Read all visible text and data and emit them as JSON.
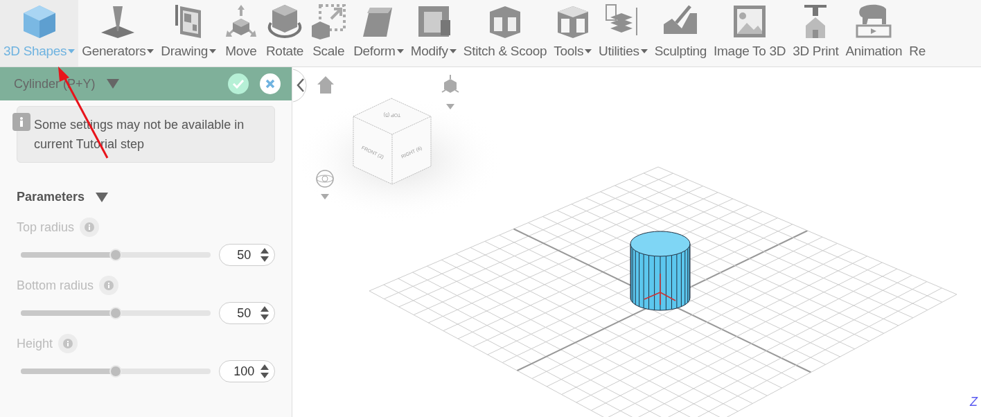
{
  "toolbar": [
    {
      "label": "3D Shapes",
      "dropdown": true,
      "selected": true
    },
    {
      "label": "Generators",
      "dropdown": true,
      "selected": false
    },
    {
      "label": "Drawing",
      "dropdown": true,
      "selected": false
    },
    {
      "label": "Move",
      "dropdown": false,
      "selected": false
    },
    {
      "label": "Rotate",
      "dropdown": false,
      "selected": false
    },
    {
      "label": "Scale",
      "dropdown": false,
      "selected": false
    },
    {
      "label": "Deform",
      "dropdown": true,
      "selected": false
    },
    {
      "label": "Modify",
      "dropdown": true,
      "selected": false
    },
    {
      "label": "Stitch & Scoop",
      "dropdown": false,
      "selected": false
    },
    {
      "label": "Tools",
      "dropdown": true,
      "selected": false
    },
    {
      "label": "Utilities",
      "dropdown": true,
      "selected": false
    },
    {
      "label": "Sculpting",
      "dropdown": false,
      "selected": false
    },
    {
      "label": "Image To 3D",
      "dropdown": false,
      "selected": false
    },
    {
      "label": "3D Print",
      "dropdown": false,
      "selected": false
    },
    {
      "label": "Animation",
      "dropdown": false,
      "selected": false
    },
    {
      "label": "Re",
      "dropdown": false,
      "selected": false
    }
  ],
  "panel": {
    "title": "Cylinder (P+Y)",
    "notice": "Some settings may not be available in current Tutorial step",
    "section": "Parameters",
    "params": [
      {
        "label": "Top radius",
        "disabled": true,
        "level": 0.5,
        "value": "50"
      },
      {
        "label": "Bottom radius",
        "disabled": true,
        "level": 0.5,
        "value": "50"
      },
      {
        "label": "Height",
        "disabled": true,
        "level": 0.5,
        "value": "100"
      }
    ]
  },
  "viewport": {
    "view_cube": {
      "top": "TOP (5)",
      "front": "FRONT (2)",
      "right": "RIGHT (6)"
    },
    "axis_label": "Z"
  }
}
